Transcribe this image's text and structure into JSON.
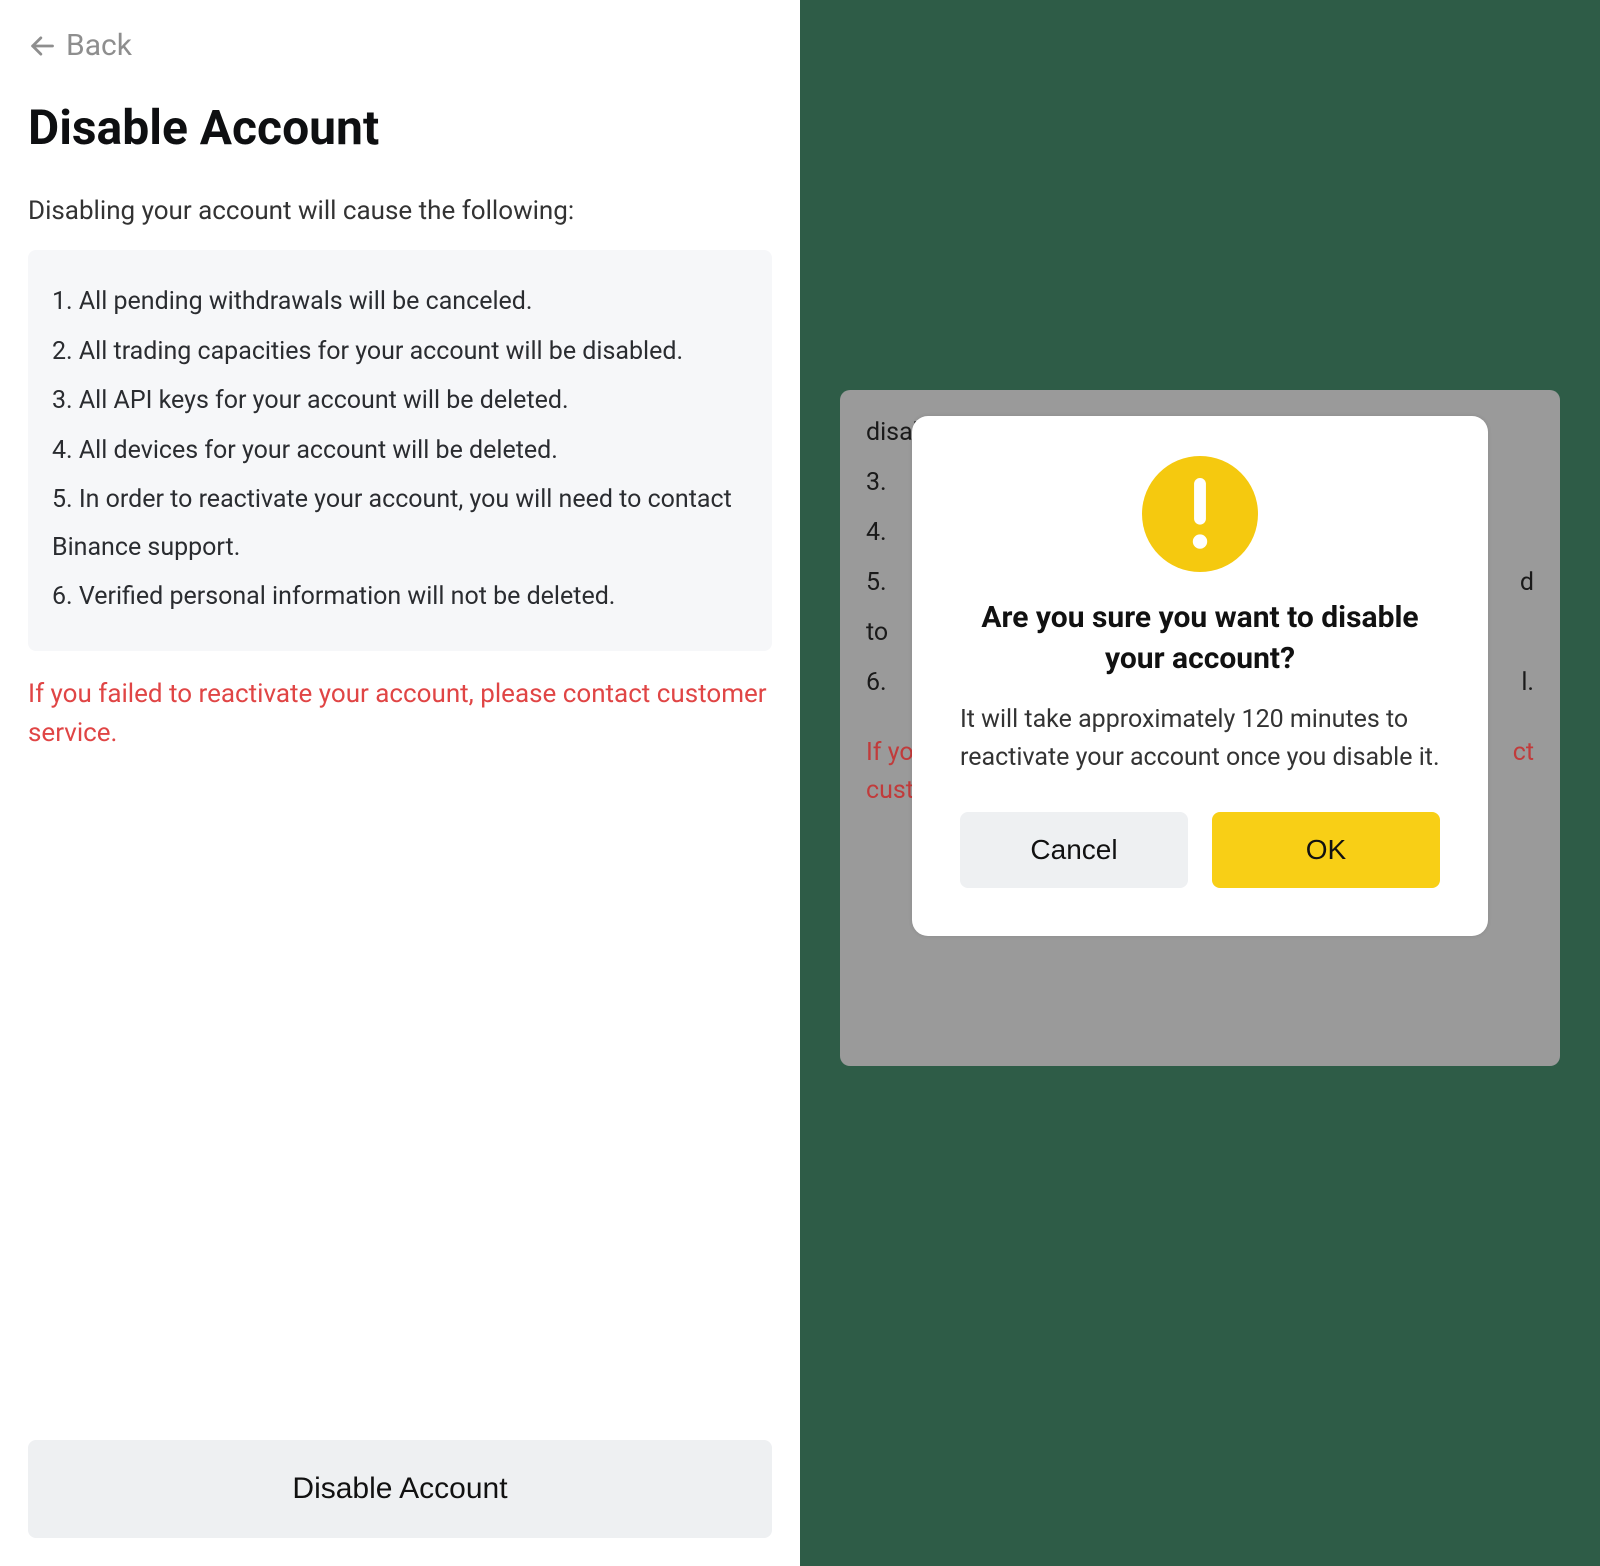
{
  "colors": {
    "background_green": "#2e5c47",
    "accent_yellow": "#f8cf16",
    "warning_red": "#e04545"
  },
  "left": {
    "back_label": "Back",
    "heading": "Disable Account",
    "lead": "Disabling your account will cause the following:",
    "items": {
      "i1": "1. All pending withdrawals will be canceled.",
      "i2": "2. All trading capacities for your account will be disabled.",
      "i3": "3. All API keys for your account will be deleted.",
      "i4": "4. All devices for your account will be deleted.",
      "i5": "5. In order to reactivate your account, you will need to contact Binance support.",
      "i6": "6. Verified personal information will not be deleted."
    },
    "warning": "If you failed to reactivate your account, please contact customer service.",
    "disable_button": "Disable Account"
  },
  "right": {
    "behind": {
      "l1": "disabled.",
      "l2": "3.",
      "l3": "4.",
      "l4_pre": "5.",
      "l4_post": "d",
      "l5": "to",
      "l6_pre": "6.",
      "l6_post": "l.",
      "warn_pre": "If you",
      "warn_post": "ct",
      "warn2": "custo"
    },
    "modal": {
      "title": "Are you sure you want to disable your account?",
      "body": "It will take approximately 120 minutes to reactivate your account once you disable it.",
      "cancel": "Cancel",
      "ok": "OK"
    }
  }
}
